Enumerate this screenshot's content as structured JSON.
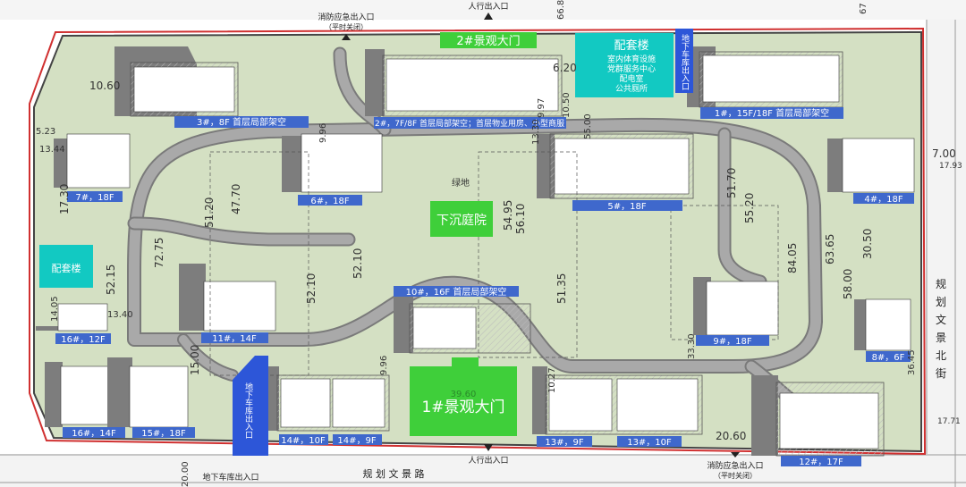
{
  "colors": {
    "site": "#d4e0c3",
    "road": "#a9a9a9",
    "road_edge": "#7a7a7a",
    "building_shadow": "#7d7d7d",
    "building": "#ffffff",
    "label_bg": "#3f68cc",
    "label_text": "#ffffff",
    "green_gate": "#3fcf3a",
    "teal": "#12c9c2",
    "entrance_blue": "#2d56d8",
    "boundary": "#d03030"
  },
  "gates": {
    "top_gate": "2#景观大门",
    "main_gate": "1#景观大门",
    "main_gate_dim": "39.60",
    "sunken_court": "下沉庭院",
    "green_area": "绿地"
  },
  "facilities": {
    "top_right_title": "配套楼",
    "top_right_lines": [
      "室内体育设施",
      "党群服务中心",
      "配电室",
      "公共厕所"
    ],
    "left_title": "配套楼"
  },
  "entrances": {
    "underground_left": "地下车库出入口",
    "underground_top": "地下车库出入口",
    "fire_top": "消防应急出入口",
    "fire_top_note": "（平时关闭）",
    "fire_bottom": "消防应急出入口",
    "fire_bottom_note": "（平时关闭）",
    "pedestrian_top": "人行出入口",
    "pedestrian_bottom": "人行出入口",
    "underground_bottom": "地下车库出入口"
  },
  "roads": {
    "bottom": "规 划 文 景 路",
    "right": [
      "规",
      "划",
      "文",
      "景",
      "北",
      "街"
    ]
  },
  "buildings": [
    {
      "label": "3#，8F 首层局部架空"
    },
    {
      "label": "2#，7F/8F 首层局部架空；首层物业用房、小型商服"
    },
    {
      "label": "1#，15F/18F 首层局部架空"
    },
    {
      "label": "7#，18F"
    },
    {
      "label": "6#，18F"
    },
    {
      "label": "5#，18F"
    },
    {
      "label": "4#，18F"
    },
    {
      "label": "10#，16F 首层局部架空"
    },
    {
      "label": "16#，12F"
    },
    {
      "label": "11#，14F"
    },
    {
      "label": "9#，18F"
    },
    {
      "label": "8#，6F"
    },
    {
      "label": "16#，14F"
    },
    {
      "label": "15#，18F"
    },
    {
      "label": "14#，10F"
    },
    {
      "label": "14#，9F"
    },
    {
      "label": "13#，9F"
    },
    {
      "label": "13#，10F"
    },
    {
      "label": "12#，17F"
    }
  ],
  "dimensions": [
    "10.60",
    "5.23",
    "13.44",
    "17.30",
    "72.75",
    "52.15",
    "14.05",
    "13.40",
    "47.70",
    "51.20",
    "52.10",
    "52.10",
    "15.00",
    "9.96",
    "54.95",
    "56.10",
    "51.35",
    "51.70",
    "55.20",
    "84.05",
    "63.65",
    "58.00",
    "30.50",
    "36.45",
    "20.60",
    "10.27",
    "33.30",
    "9.97",
    "7.00",
    "17.93",
    "17.71",
    "20.00",
    "9.96",
    "13.30",
    "6.20",
    "10.50",
    "55.00",
    "66.8",
    "67"
  ]
}
